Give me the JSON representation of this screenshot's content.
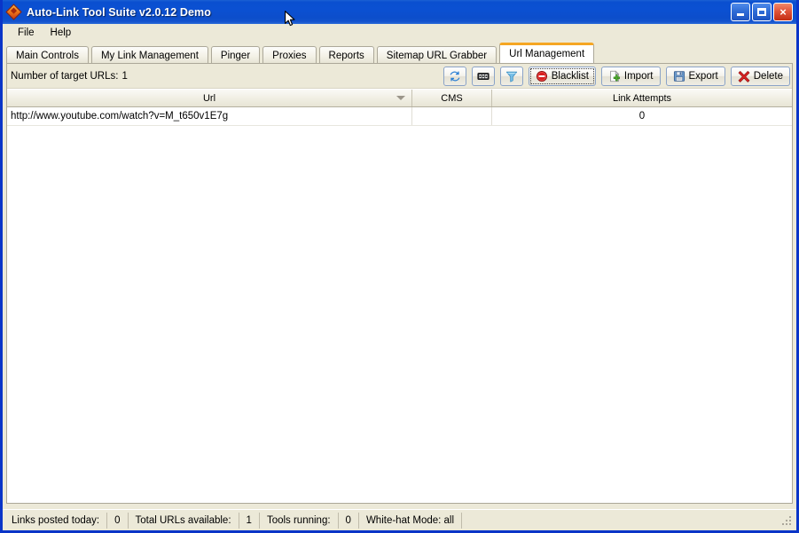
{
  "window": {
    "title": "Auto-Link Tool Suite v2.0.12 Demo",
    "icon": "diamond-app-icon",
    "minimize_label": "",
    "maximize_label": "",
    "close_label": "×"
  },
  "menubar": {
    "items": [
      {
        "label": "File"
      },
      {
        "label": "Help"
      }
    ]
  },
  "tabs": [
    {
      "label": "Main Controls",
      "active": false
    },
    {
      "label": "My Link Management",
      "active": false
    },
    {
      "label": "Pinger",
      "active": false
    },
    {
      "label": "Proxies",
      "active": false
    },
    {
      "label": "Reports",
      "active": false
    },
    {
      "label": "Sitemap URL Grabber",
      "active": false
    },
    {
      "label": "Url Management",
      "active": true
    }
  ],
  "toolbar": {
    "count_label": "Number of target URLs:",
    "count_value": "1",
    "buttons": [
      {
        "name": "refresh-button",
        "label": "",
        "icon": "refresh-icon"
      },
      {
        "name": "counter-button",
        "label": "",
        "icon": "counter-icon"
      },
      {
        "name": "filter-button",
        "label": "",
        "icon": "funnel-icon"
      },
      {
        "name": "blacklist-button",
        "label": "Blacklist",
        "icon": "no-entry-icon"
      },
      {
        "name": "import-button",
        "label": "Import",
        "icon": "document-add-icon"
      },
      {
        "name": "export-button",
        "label": "Export",
        "icon": "floppy-disk-icon"
      },
      {
        "name": "delete-button",
        "label": "Delete",
        "icon": "red-x-icon"
      }
    ]
  },
  "grid": {
    "columns": [
      {
        "label": "Url",
        "sorted": "desc"
      },
      {
        "label": "CMS",
        "sorted": ""
      },
      {
        "label": "Link Attempts",
        "sorted": ""
      }
    ],
    "rows": [
      {
        "url": "http://www.youtube.com/watch?v=M_t650v1E7g",
        "cms": "",
        "link_attempts": "0"
      }
    ]
  },
  "statusbar": {
    "panels": [
      {
        "label": "Links posted today:",
        "value": "0"
      },
      {
        "label": "Total URLs available:",
        "value": "1"
      },
      {
        "label": "Tools running:",
        "value": "0"
      },
      {
        "label": "White-hat Mode: all",
        "value": ""
      }
    ]
  },
  "colors": {
    "titlebar_blue": "#0b50d2",
    "frame_blue": "#0a35c8",
    "face": "#ece9d8",
    "active_tab_accent": "#f5a623",
    "grid_bg": "#ffffff"
  }
}
